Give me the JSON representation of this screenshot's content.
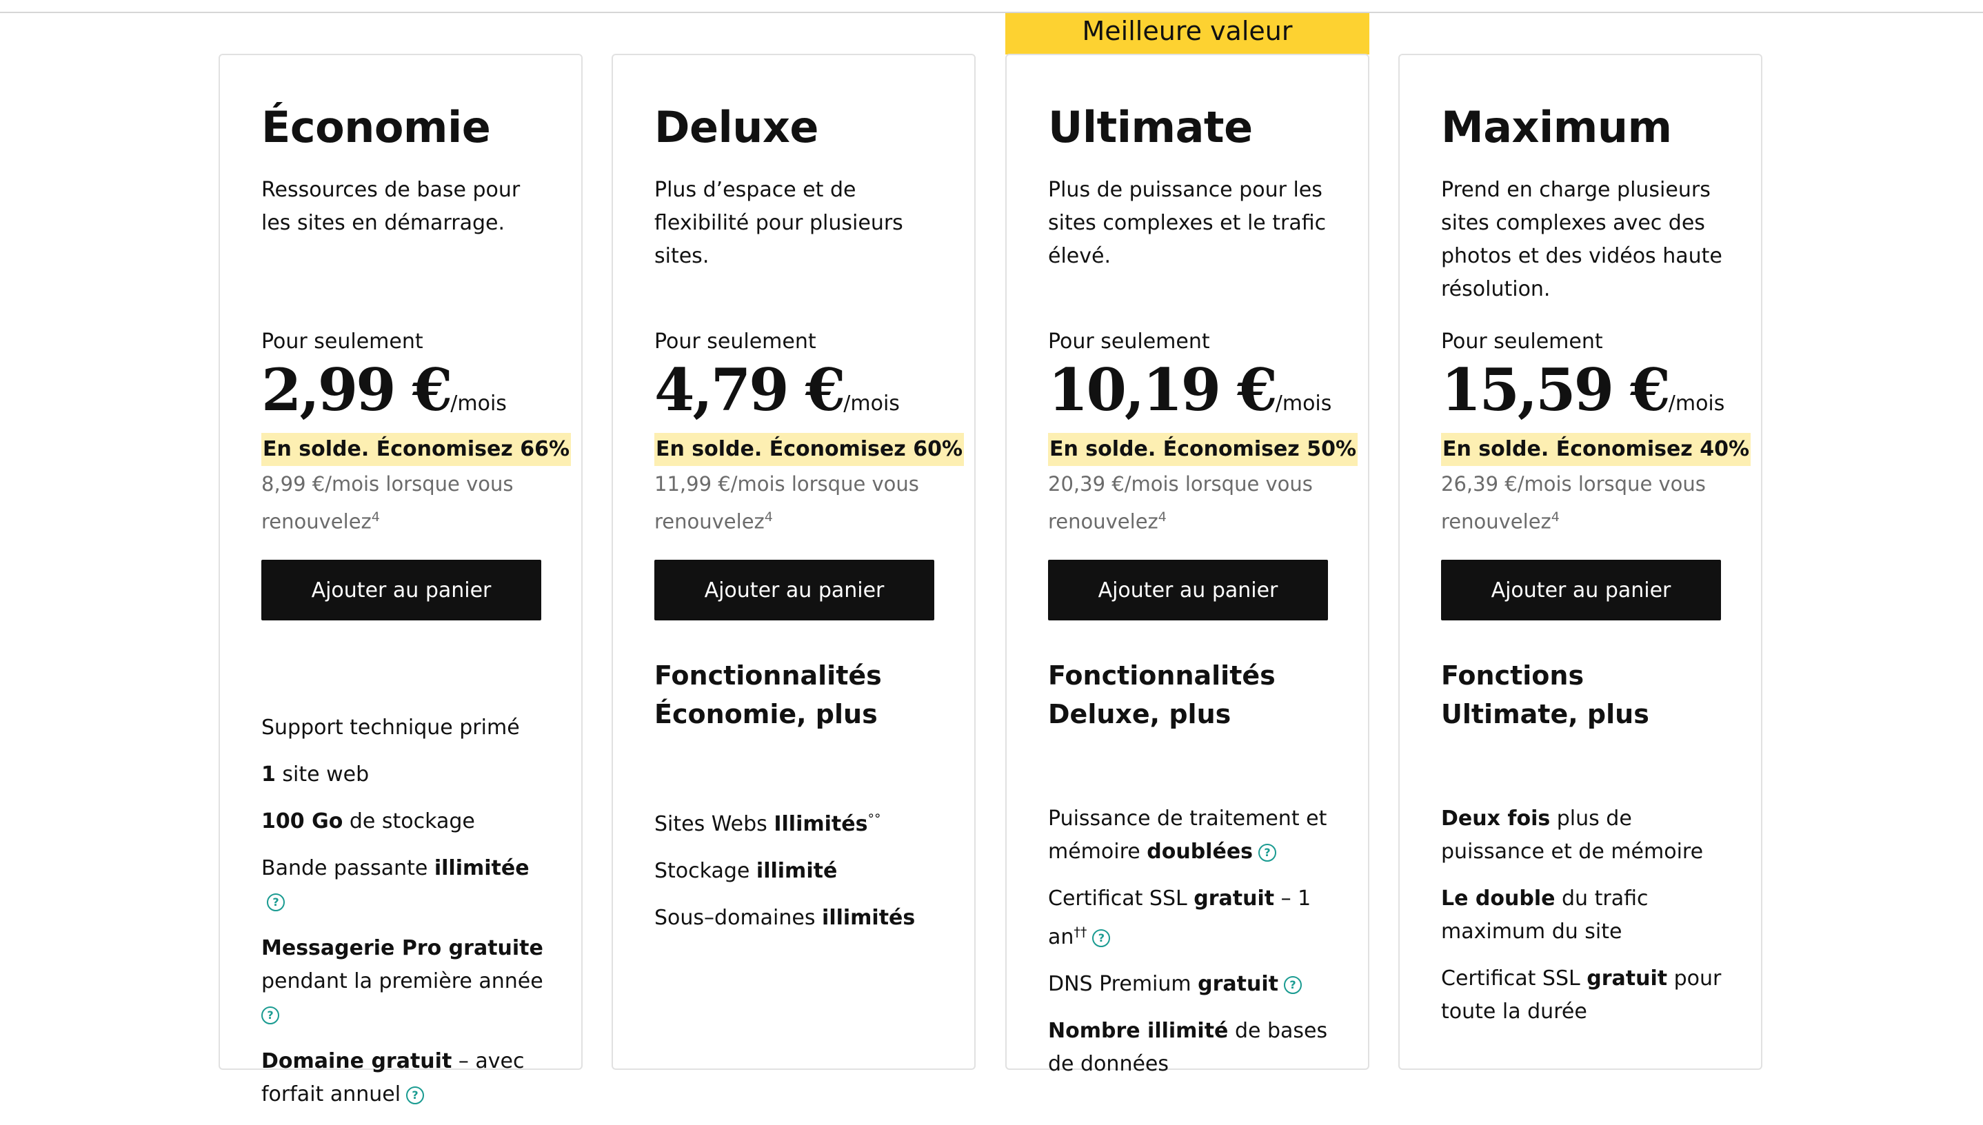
{
  "badge": {
    "label": "Meilleure valeur"
  },
  "colors": {
    "badge": "#fdd231",
    "sale_highlight": "#fdefb2",
    "cta": "#111111",
    "help_icon": "#1a9b91"
  },
  "plans": [
    {
      "name": "Économie",
      "description": "Ressources de base pour les sites en démarrage.",
      "price_label": "Pour seulement",
      "price": "2,99 €",
      "per": "/mois",
      "sale": "En solde. Économisez 66%",
      "renew_text": "8,99 €/mois lorsque vous renouvelez",
      "renew_sup": "4",
      "cta": "Ajouter au panier",
      "features": [
        {
          "pre": "",
          "bold": "",
          "post": "Support technique primé",
          "sup": ""
        },
        {
          "pre": "",
          "bold": "1",
          "post": " site web",
          "sup": ""
        },
        {
          "pre": "",
          "bold": "100 Go",
          "post": " de stockage",
          "sup": ""
        },
        {
          "pre": "Bande passante ",
          "bold": "illimitée",
          "post": "",
          "sup": "",
          "help": "?"
        },
        {
          "pre": "",
          "bold": "Messagerie Pro gratuite",
          "post": " pendant la première année",
          "sup": "",
          "help": "?"
        },
        {
          "pre": "",
          "bold": "Domaine gratuit",
          "post": " – avec forfait annuel",
          "sup": "",
          "help": "?"
        }
      ]
    },
    {
      "name": "Deluxe",
      "description": "Plus d’espace et de flexibilité pour plusieurs sites.",
      "price_label": "Pour seulement",
      "price": "4,79 €",
      "per": "/mois",
      "sale": "En solde. Économisez 60%",
      "renew_text": "11,99 €/mois lorsque vous renouvelez",
      "renew_sup": "4",
      "cta": "Ajouter au panier",
      "features_title": "Fonctionnalités Économie, plus",
      "features": [
        {
          "pre": "Sites Webs ",
          "bold": "Illimités",
          "post": "",
          "sup": "°°"
        },
        {
          "pre": "Stockage ",
          "bold": "illimité",
          "post": "",
          "sup": ""
        },
        {
          "pre": "Sous–domaines ",
          "bold": "illimités",
          "post": "",
          "sup": ""
        }
      ]
    },
    {
      "name": "Ultimate",
      "description": "Plus de puissance pour les sites complexes et le trafic élevé.",
      "price_label": "Pour seulement",
      "price": "10,19 €",
      "per": "/mois",
      "sale": "En solde. Économisez 50%",
      "renew_text": "20,39 €/mois lorsque vous renouvelez",
      "renew_sup": "4",
      "cta": "Ajouter au panier",
      "features_title": "Fonctionnalités Deluxe, plus",
      "features": [
        {
          "pre": "Puissance de traitement et mémoire ",
          "bold": "doublées",
          "post": "",
          "sup": "",
          "help": "?"
        },
        {
          "pre": "Certificat SSL ",
          "bold": "gratuit",
          "post": " – 1 an",
          "sup": "††",
          "help": "?"
        },
        {
          "pre": "DNS Premium ",
          "bold": "gratuit",
          "post": "",
          "sup": "",
          "help": "?"
        },
        {
          "pre": "",
          "bold": "Nombre illimité",
          "post": " de bases de données",
          "sup": ""
        }
      ]
    },
    {
      "name": "Maximum",
      "description": "Prend en charge plusieurs sites complexes avec des photos et des vidéos haute résolution.",
      "price_label": "Pour seulement",
      "price": "15,59 €",
      "per": "/mois",
      "sale": "En solde. Économisez 40%",
      "renew_text": "26,39 €/mois lorsque vous renouvelez",
      "renew_sup": "4",
      "cta": "Ajouter au panier",
      "features_title": "Fonctions Ultimate, plus",
      "features": [
        {
          "pre": "",
          "bold": "Deux fois",
          "post": " plus de puissance et de mémoire",
          "sup": ""
        },
        {
          "pre": "",
          "bold": "Le double",
          "post": " du trafic maximum du site",
          "sup": ""
        },
        {
          "pre": "Certificat SSL ",
          "bold": "gratuit",
          "post": " pour toute la durée",
          "sup": ""
        }
      ]
    }
  ]
}
